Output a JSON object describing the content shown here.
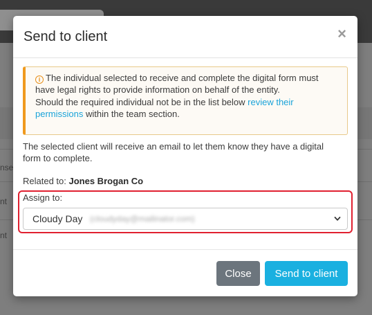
{
  "background": {
    "fragments": [
      "nsen",
      "nt",
      "nt"
    ]
  },
  "modal": {
    "title": "Send to client",
    "close_symbol": "×",
    "alert": {
      "icon": "info-icon",
      "line1": "The individual selected to receive and complete the digital form must have legal rights to provide information on behalf of the entity.",
      "line2_prefix": "Should the required individual not be in the list below ",
      "line2_link": "review their permissions",
      "line2_suffix": " within the team section."
    },
    "info_text": "The selected client will receive an email to let them know they have a digital form to complete.",
    "related_label": "Related to: ",
    "related_value": "Jones Brogan Co",
    "assign_label": "Assign to:",
    "assign_select": {
      "selected_name": "Cloudy Day",
      "selected_email": "(cloudyday@mailinator.com)"
    },
    "buttons": {
      "close": "Close",
      "send": "Send to client"
    }
  },
  "colors": {
    "primary": "#1ab0e0",
    "secondary": "#6c757d",
    "warning": "#f09a1e",
    "highlight": "#e02030",
    "link": "#1aa3d9"
  }
}
